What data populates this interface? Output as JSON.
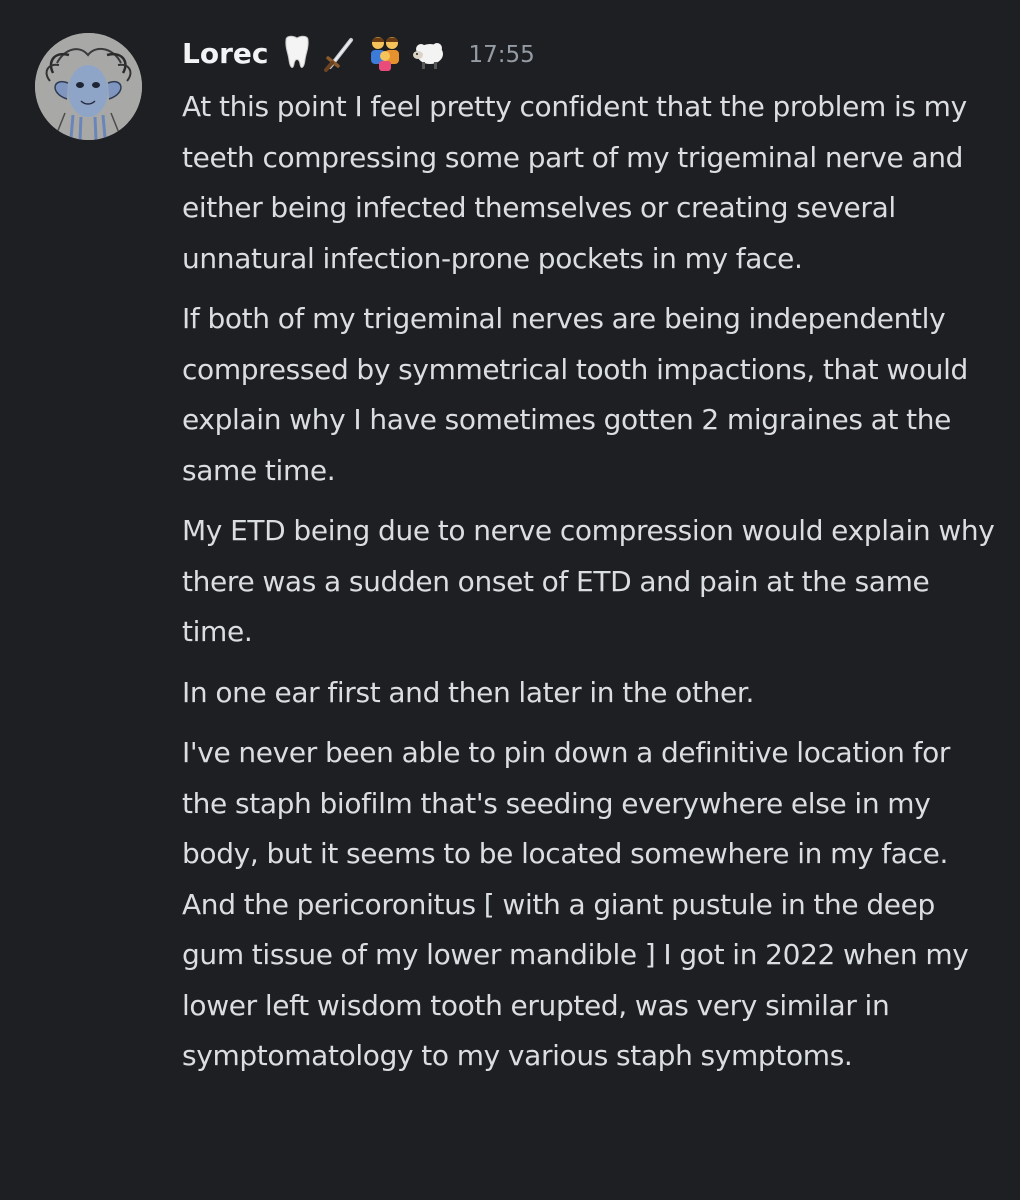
{
  "message": {
    "author": {
      "name": "Lorec",
      "badges": [
        "tooth-icon",
        "dagger-icon",
        "family-icon",
        "sheep-icon"
      ]
    },
    "timestamp": "17:55",
    "paragraphs": [
      "At this point I feel pretty confident that the problem is my teeth compressing some part of my trigeminal nerve and either being infected themselves or creating several unnatural infection-prone pockets in my face.",
      "If both of my trigeminal nerves are being independently compressed by symmetrical tooth impactions, that would explain why I have sometimes gotten 2 migraines at the same time.",
      "My ETD being due to nerve compression would explain why there was a sudden onset of ETD and pain at the same time.",
      "In one ear first and then later in the other.",
      "I've never been able to pin down a definitive location for the staph biofilm that's seeding everywhere else in my body, but it seems to be located somewhere in my face. And the pericoronitus [ with a giant pustule in the deep gum tissue of my lower mandible ] I got in 2022 when my lower left wisdom tooth erupted, was very similar in symptomatology to my various staph symptoms."
    ]
  },
  "colors": {
    "background": "#1e1f22",
    "text": "#dbdee1",
    "username": "#f2f3f5",
    "timestamp": "#949ba4"
  }
}
